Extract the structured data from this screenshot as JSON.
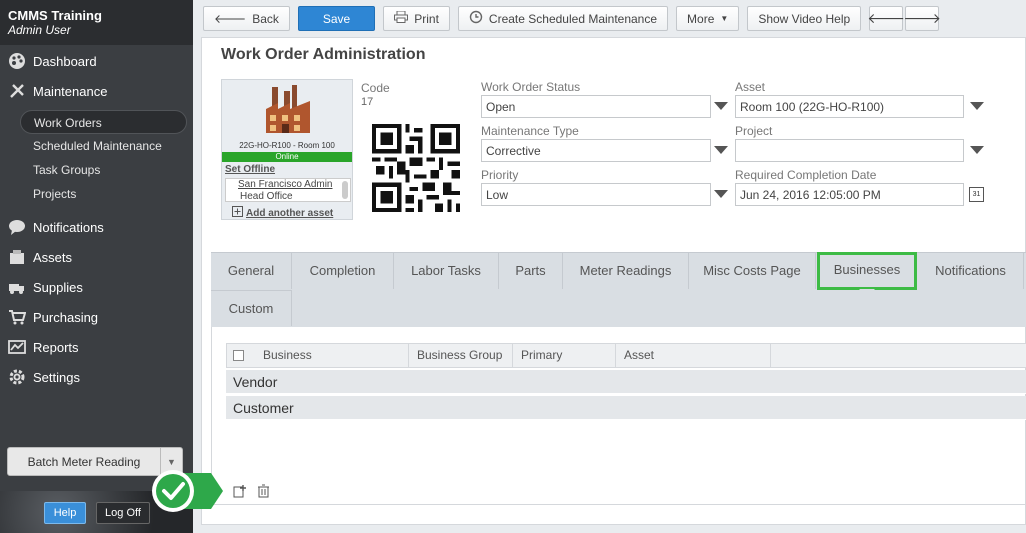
{
  "app": {
    "title": "CMMS Training",
    "user": "Admin User"
  },
  "sidebar": {
    "items": [
      {
        "label": "Dashboard",
        "icon": "palette-icon"
      },
      {
        "label": "Maintenance",
        "icon": "tools-icon"
      },
      {
        "label": "Notifications",
        "icon": "speech-bubble-icon"
      },
      {
        "label": "Assets",
        "icon": "assets-icon"
      },
      {
        "label": "Supplies",
        "icon": "truck-icon"
      },
      {
        "label": "Purchasing",
        "icon": "cart-icon"
      },
      {
        "label": "Reports",
        "icon": "chart-icon"
      },
      {
        "label": "Settings",
        "icon": "gear-icon"
      }
    ],
    "subitems": [
      "Work Orders",
      "Scheduled Maintenance",
      "Task Groups",
      "Projects"
    ],
    "batch_label": "Batch Meter Reading",
    "help_label": "Help",
    "logoff_label": "Log Off"
  },
  "toolbar": {
    "back": "Back",
    "save": "Save",
    "print": "Print",
    "create_sched": "Create Scheduled Maintenance",
    "more": "More",
    "video": "Show Video Help"
  },
  "page": {
    "title": "Work Order Administration"
  },
  "asset_card": {
    "caption": "22G-HO-R100 - Room 100",
    "status": "Online",
    "set_offline": "Set Offline",
    "location": "San Francisco Admin",
    "sublocation": "Head Office",
    "add_asset": "Add another asset"
  },
  "code": {
    "label": "Code",
    "value": "17"
  },
  "fields": {
    "status": {
      "label": "Work Order Status",
      "value": "Open"
    },
    "asset": {
      "label": "Asset",
      "value": "Room 100 (22G-HO-R100)"
    },
    "mtype": {
      "label": "Maintenance Type",
      "value": "Corrective"
    },
    "project": {
      "label": "Project",
      "value": ""
    },
    "priority": {
      "label": "Priority",
      "value": "Low"
    },
    "completion": {
      "label": "Required Completion Date",
      "value": "Jun 24, 2016 12:05:00 PM"
    }
  },
  "tabs": [
    "General",
    "Completion",
    "Labor Tasks",
    "Parts",
    "Meter Readings",
    "Misc Costs Page",
    "Businesses",
    "Notifications",
    "Custom"
  ],
  "grid": {
    "columns": [
      "Business",
      "Business Group",
      "Primary",
      "Asset"
    ],
    "groups": [
      "Vendor",
      "Customer"
    ]
  },
  "colors": {
    "accent": "#2e86d4",
    "highlight": "#3dbb45"
  }
}
